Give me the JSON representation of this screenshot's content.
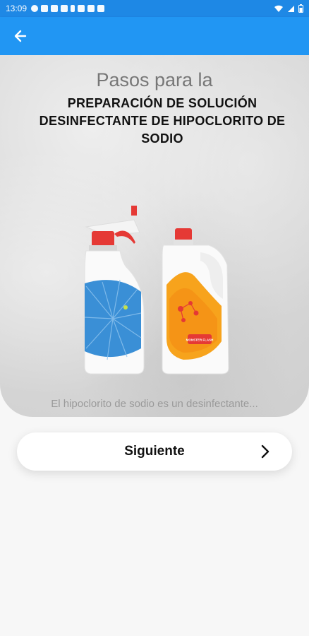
{
  "status_bar": {
    "time": "13:09",
    "notification_icons": [
      "whatsapp-icon",
      "square-icon",
      "square-icon",
      "ff-icon",
      "usb-icon",
      "check-icon",
      "image-icon",
      "youtube-icon"
    ],
    "system_icons": [
      "wifi-icon",
      "signal-icon",
      "battery-icon"
    ]
  },
  "app_bar": {
    "back_icon": "arrow-left-icon",
    "color": "#2196f3"
  },
  "hero": {
    "title_small": "Pasos para la",
    "title_main": "PREPARACIÓN DE SOLUCIÓN DESINFECTANTE DE HIPOCLORITO DE SODIO",
    "bottle_label": "MONSTER FLASH"
  },
  "caption": "El hipoclorito de sodio es un desinfectante...",
  "next_button": {
    "label": "Siguiente",
    "icon": "chevron-right-icon"
  }
}
